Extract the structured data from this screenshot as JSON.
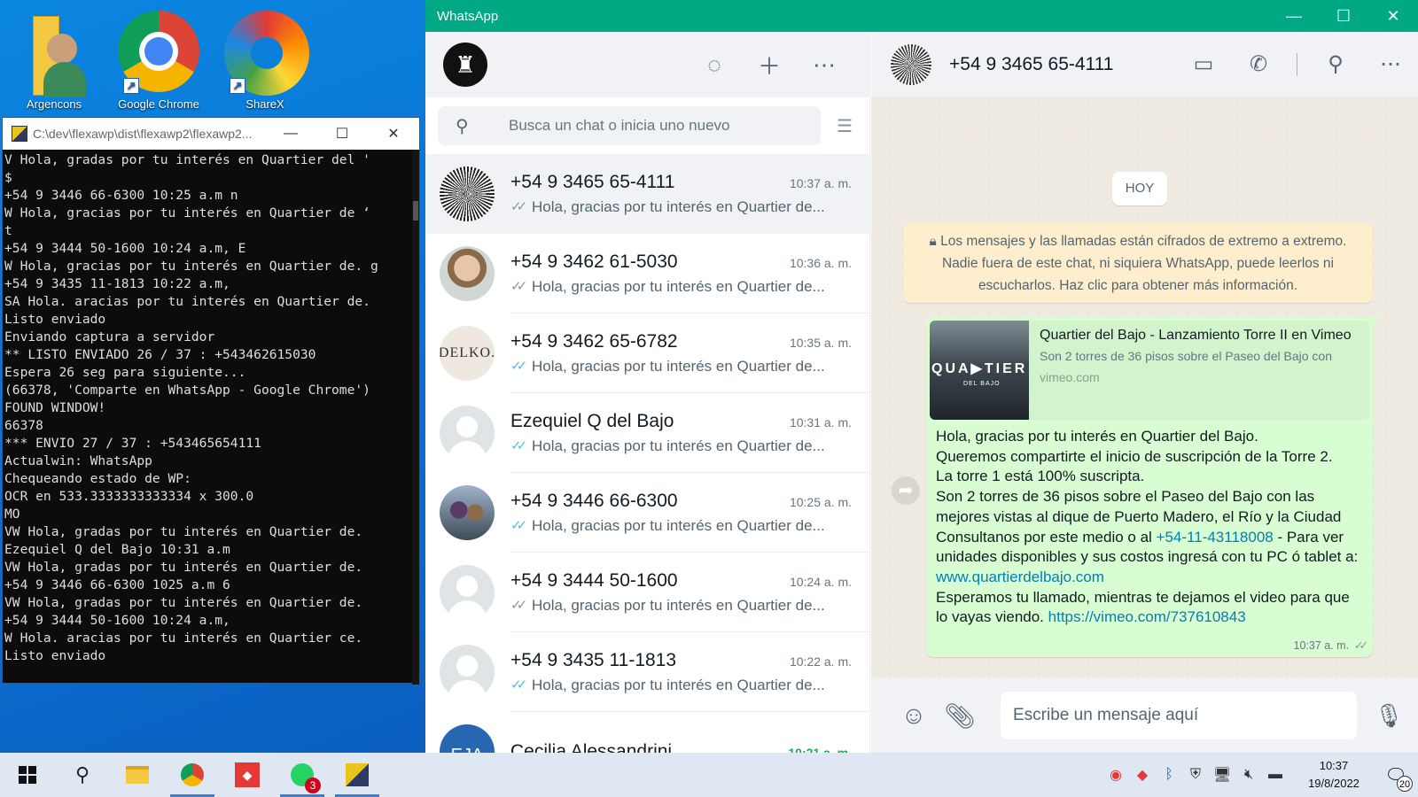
{
  "desktop": {
    "icons": [
      {
        "label": "Argencons"
      },
      {
        "label": "Google Chrome"
      },
      {
        "label": "ShareX"
      }
    ]
  },
  "console": {
    "title": "C:\\dev\\flexawp\\dist\\flexawp2\\flexawp2...",
    "lines": [
      "V Hola, gradas por tu interés en Quartier del '",
      "$",
      "+54 9 3446 66-6300 10:25 a.m n",
      "W Hola, gracias por tu interés en Quartier de ‘",
      "t",
      "+54 9 3444 50-1600 10:24 a.m, E",
      "W Hola, gracias por tu interés en Quartier de. g",
      "+54 9 3435 11-1813 10:22 a.m,",
      "SA Hola. aracias por tu interés en Quartier de.",
      "Listo enviado",
      "Enviando captura a servidor",
      "** LISTO ENVIADO 26 / 37 : +543462615030",
      "Espera 26 seg para siguiente...",
      "(66378, 'Comparte en WhatsApp - Google Chrome')",
      "FOUND WINDOW!",
      "66378",
      "*** ENVIO 27 / 37 : +543465654111",
      "Actualwin: WhatsApp",
      "Chequeando estado de WP:",
      "OCR en 533.3333333333334 x 300.0",
      "MO",
      "VW Hola, gradas por tu interés en Quartier de.",
      "Ezequiel Q del Bajo 10:31 a.m",
      "VW Hola, gradas por tu interés en Quartier de.",
      "+54 9 3446 66-6300 1025 a.m 6",
      "VW Hola, gradas por tu interés en Quartier de.",
      "+54 9 3444 50-1600 10:24 a.m,",
      "W Hola. aracias por tu interés en Quartier ce.",
      "Listo enviado"
    ]
  },
  "whatsapp": {
    "window_title": "WhatsApp",
    "search_placeholder": "Busca un chat o inicia uno nuevo",
    "chats": [
      {
        "name": "+54 9 3465 65-4111",
        "time": "10:37 a. m.",
        "preview": "Hola, gracias por tu interés en Quartier de...",
        "ticks": "grey",
        "avatar": "starburst"
      },
      {
        "name": "+54 9 3462 61-5030",
        "time": "10:36 a. m.",
        "preview": "Hola, gracias por tu interés en Quartier de...",
        "ticks": "grey",
        "avatar": "photo1"
      },
      {
        "name": "+54 9 3462 65-6782",
        "time": "10:35 a. m.",
        "preview": "Hola, gracias por tu interés en Quartier de...",
        "ticks": "blue",
        "avatar": "delko",
        "avatar_text": "DELKO."
      },
      {
        "name": "Ezequiel Q del Bajo",
        "time": "10:31 a. m.",
        "preview": "Hola, gracias por tu interés en Quartier de...",
        "ticks": "blue",
        "avatar": "blank"
      },
      {
        "name": "+54 9 3446 66-6300",
        "time": "10:25 a. m.",
        "preview": "Hola, gracias por tu interés en Quartier de...",
        "ticks": "blue",
        "avatar": "group"
      },
      {
        "name": "+54 9 3444 50-1600",
        "time": "10:24 a. m.",
        "preview": "Hola, gracias por tu interés en Quartier de...",
        "ticks": "grey",
        "avatar": "blank"
      },
      {
        "name": "+54 9 3435 11-1813",
        "time": "10:22 a. m.",
        "preview": "Hola, gracias por tu interés en Quartier de...",
        "ticks": "blue",
        "avatar": "blank"
      },
      {
        "name": "Cecilia Alessandrini",
        "time": "10:21 a. m.",
        "preview": "",
        "ticks": "none",
        "avatar": "initials",
        "avatar_text": "EJA",
        "time_unread": true
      }
    ],
    "conversation": {
      "contact": "+54 9 3465 65-4111",
      "day_chip": "HOY",
      "encryption_notice": "Los mensajes y las llamadas están cifrados de extremo a extremo. Nadie fuera de este chat, ni siquiera WhatsApp, puede leerlos ni escucharlos. Haz clic para obtener más información.",
      "link_preview": {
        "title": "Quartier del Bajo - Lanzamiento Torre II en Vimeo",
        "description": "Son 2 torres de 36 pisos sobre el Paseo del Bajo con",
        "domain": "vimeo.com",
        "thumb_text": "QUA▶TIER",
        "thumb_sub": "DEL BAJO"
      },
      "message": {
        "p1": "Hola, gracias por tu interés en Quartier del Bajo.",
        "p2": "Queremos compartirte el inicio de suscripción de la Torre 2.",
        "p3": "La torre 1 está 100% suscripta.",
        "p4": "Son 2 torres de 36 pisos sobre el Paseo del Bajo con las mejores vistas al dique de Puerto Madero, el Río y la Ciudad",
        "p5a": "Consultanos por este medio o al ",
        "phone_link": "+54-11-43118008",
        "p5b": " - Para ver unidades disponibles y sus costos ingresá con tu PC ó tablet a: ",
        "site_link": "www.quartierdelbajo.com",
        "p6": "Esperamos tu llamado, mientras te dejamos el video para que lo vayas viendo. ",
        "video_link": "https://vimeo.com/737610843",
        "time": "10:37 a. m."
      },
      "composer_placeholder": "Escribe un mensaje aquí"
    }
  },
  "taskbar": {
    "whatsapp_badge": "3",
    "clock_time": "10:37",
    "clock_date": "19/8/2022",
    "notification_count": "20"
  }
}
